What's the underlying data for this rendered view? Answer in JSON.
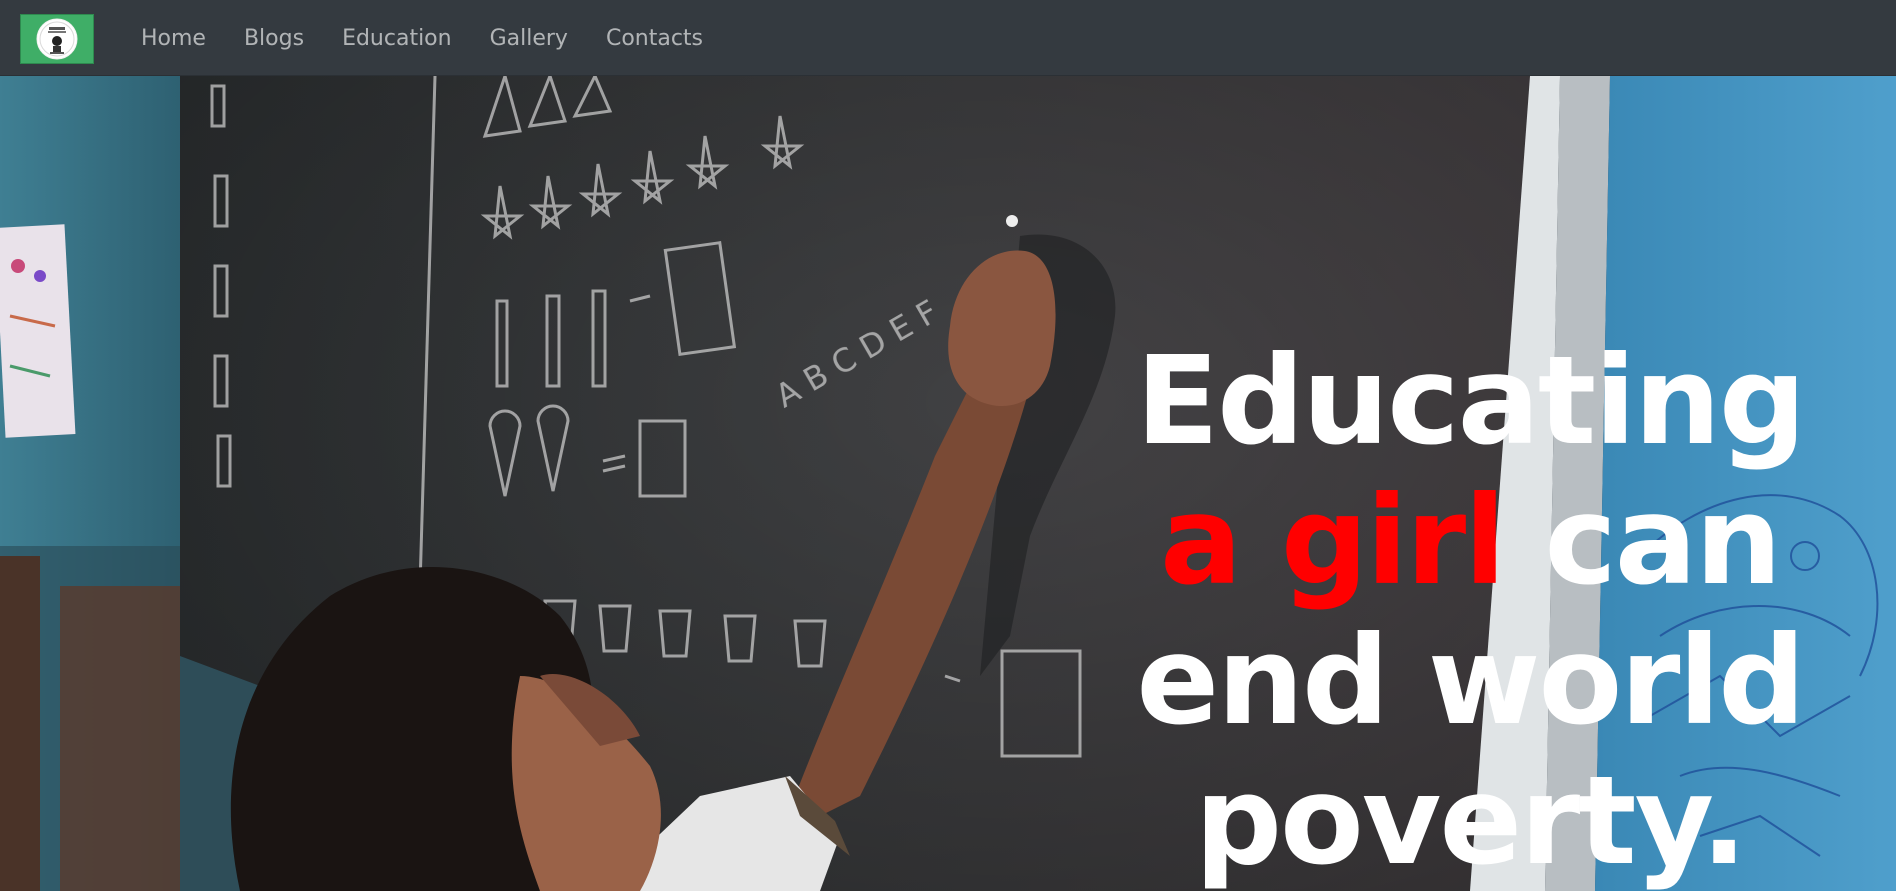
{
  "navbar": {
    "logo_alt_icon": "girls-education-logo-icon",
    "links": [
      "Home",
      "Blogs",
      "Education",
      "Gallery",
      "Contacts"
    ]
  },
  "hero": {
    "headline": {
      "line1": "Educating",
      "line2_highlight": "a girl",
      "line2_rest": " can",
      "line3": "end world",
      "line4": "poverty."
    },
    "highlight_color": "#ff0000",
    "chalk_letters": "A B C D E F"
  }
}
